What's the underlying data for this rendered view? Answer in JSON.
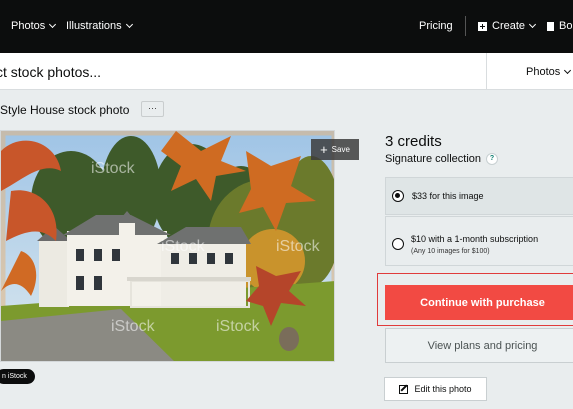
{
  "nav": {
    "photos": "Photos",
    "illustrations": "Illustrations",
    "pricing": "Pricing",
    "create": "Create",
    "boards": "Bo"
  },
  "search": {
    "placeholder": "ct stock photos...",
    "filter": "Photos"
  },
  "asset": {
    "title": "Style House stock photo",
    "more_label": "···",
    "save_label": "Save",
    "watermark": "iStock",
    "badge": "n iStock"
  },
  "purchase": {
    "credits": "3 credits",
    "collection": "Signature collection",
    "help_icon": "?",
    "option1": "$33 for this image",
    "option2_line1": "$10 with a 1-month subscription",
    "option2_line2": "(Any 10 images for $100)",
    "buy_label": "Continue with purchase",
    "plans_label": "View plans and pricing",
    "edit_label": "Edit this photo",
    "accent_color": "#f24a43"
  }
}
